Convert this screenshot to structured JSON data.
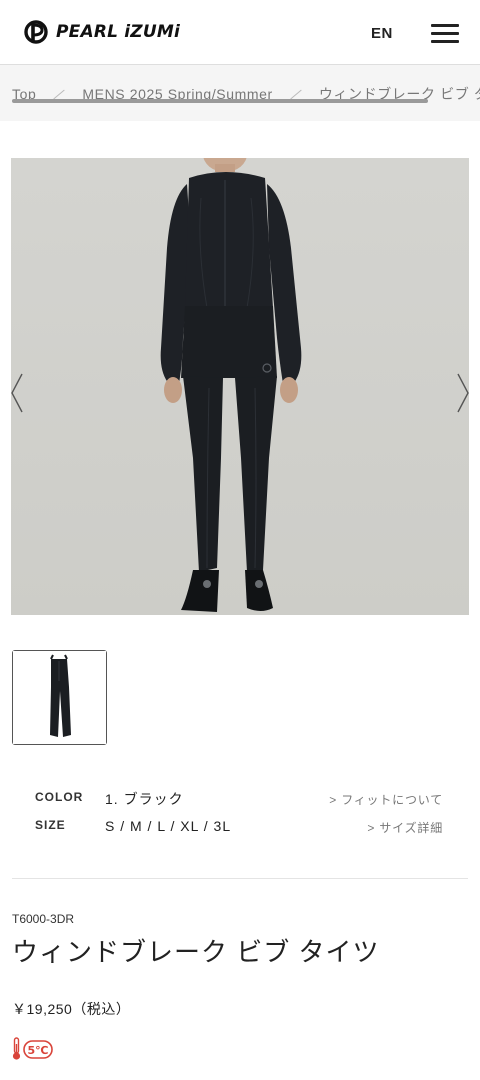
{
  "header": {
    "brand": "PEARL iZUMi",
    "language_label": "EN",
    "menu_icon": "hamburger-menu-icon"
  },
  "breadcrumb": [
    {
      "label": "Top"
    },
    {
      "label": "MENS 2025 Spring/Summer"
    },
    {
      "label": "ウィンドブレーク ビブ タイツ"
    }
  ],
  "gallery": {
    "prev_icon": "chevron-left-icon",
    "next_icon": "chevron-right-icon",
    "thumbnail_count": 1
  },
  "specs": {
    "color_label": "COLOR",
    "color_value": "1. ブラック",
    "fit_link": "> フィットについて",
    "size_label": "SIZE",
    "size_value": "S / M / L / XL / 3L",
    "size_link": "> サイズ詳細"
  },
  "product": {
    "code": "T6000-3DR",
    "name": "ウィンドブレーク ビブ タイツ",
    "price": "￥19,250（税込）",
    "temperature_badge": "5℃",
    "temperature_icon": "thermometer-icon"
  },
  "colors": {
    "garment": "#1e2126",
    "background_photo": "#d3d3cf",
    "temperature_accent": "#d9443a"
  }
}
